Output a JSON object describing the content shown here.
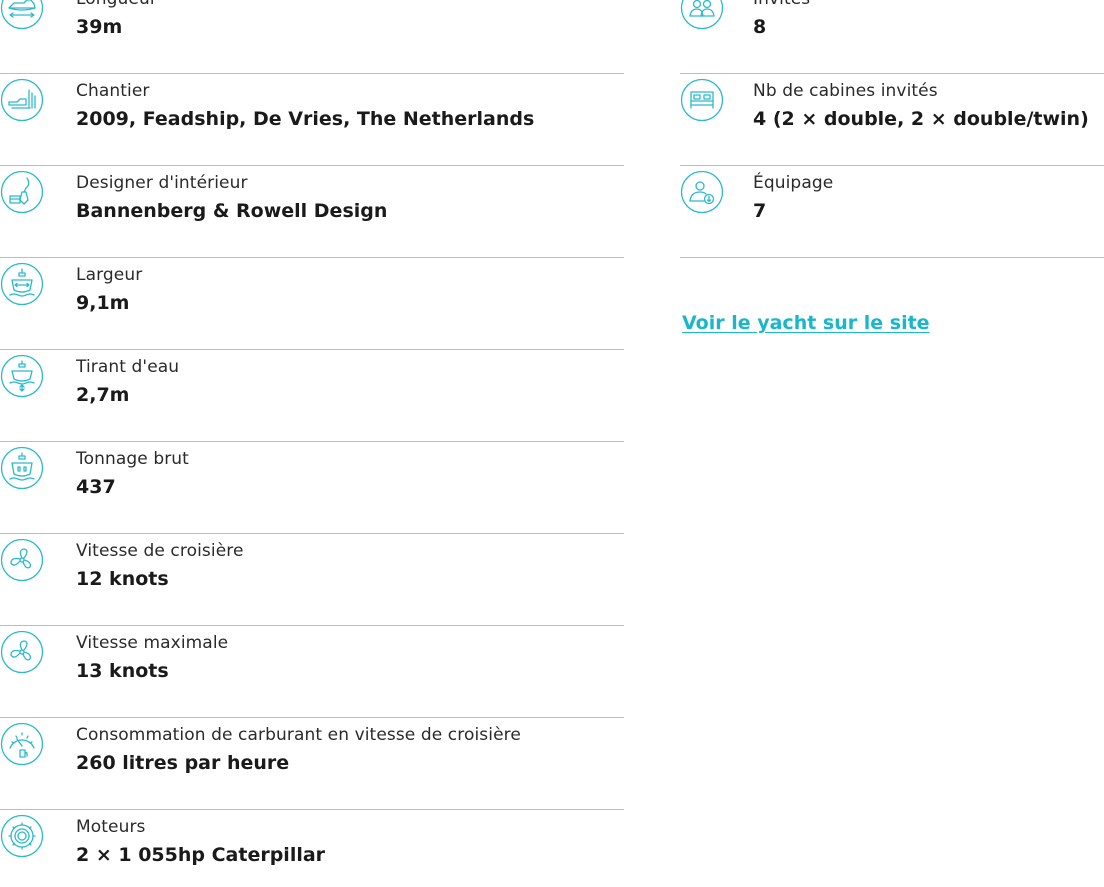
{
  "specs_left": [
    {
      "id": "length",
      "label": "Longueur",
      "value": "39m",
      "icon": "yacht-length-icon"
    },
    {
      "id": "shipyard",
      "label": "Chantier",
      "value": "2009, Feadship, De Vries, The Netherlands",
      "icon": "shipyard-icon"
    },
    {
      "id": "interior_designer",
      "label": "Designer d'intérieur",
      "value": "Bannenberg & Rowell Design",
      "icon": "interior-designer-icon"
    },
    {
      "id": "beam",
      "label": "Largeur",
      "value": "9,1m",
      "icon": "beam-icon"
    },
    {
      "id": "draft",
      "label": "Tirant d'eau",
      "value": "2,7m",
      "icon": "draft-icon"
    },
    {
      "id": "gross_tonnage",
      "label": "Tonnage brut",
      "value": "437",
      "icon": "gross-tonnage-icon"
    },
    {
      "id": "cruising_speed",
      "label": "Vitesse de croisière",
      "value": "12 knots",
      "icon": "propeller-icon"
    },
    {
      "id": "max_speed",
      "label": "Vitesse maximale",
      "value": "13 knots",
      "icon": "propeller-icon"
    },
    {
      "id": "fuel_consumption",
      "label": "Consommation de carburant en vitesse de croisière",
      "value": "260 litres par heure",
      "icon": "fuel-gauge-icon"
    },
    {
      "id": "engines",
      "label": "Moteurs",
      "value": "2 × 1 055hp Caterpillar",
      "icon": "engine-gear-icon"
    }
  ],
  "specs_right": [
    {
      "id": "guests",
      "label": "Invités",
      "value": "8",
      "icon": "guests-icon"
    },
    {
      "id": "cabins",
      "label": "Nb de cabines invités",
      "value": "4 (2 × double, 2 × double/twin)",
      "icon": "bed-icon"
    },
    {
      "id": "crew",
      "label": "Équipage",
      "value": "7",
      "icon": "crew-icon"
    }
  ],
  "site_link": {
    "label": "Voir le yacht sur le site"
  },
  "colors": {
    "accent": "#2bb9cc",
    "link": "#1ab6cc",
    "divider": "#bdbdbd",
    "text": "#1a1a1a"
  }
}
